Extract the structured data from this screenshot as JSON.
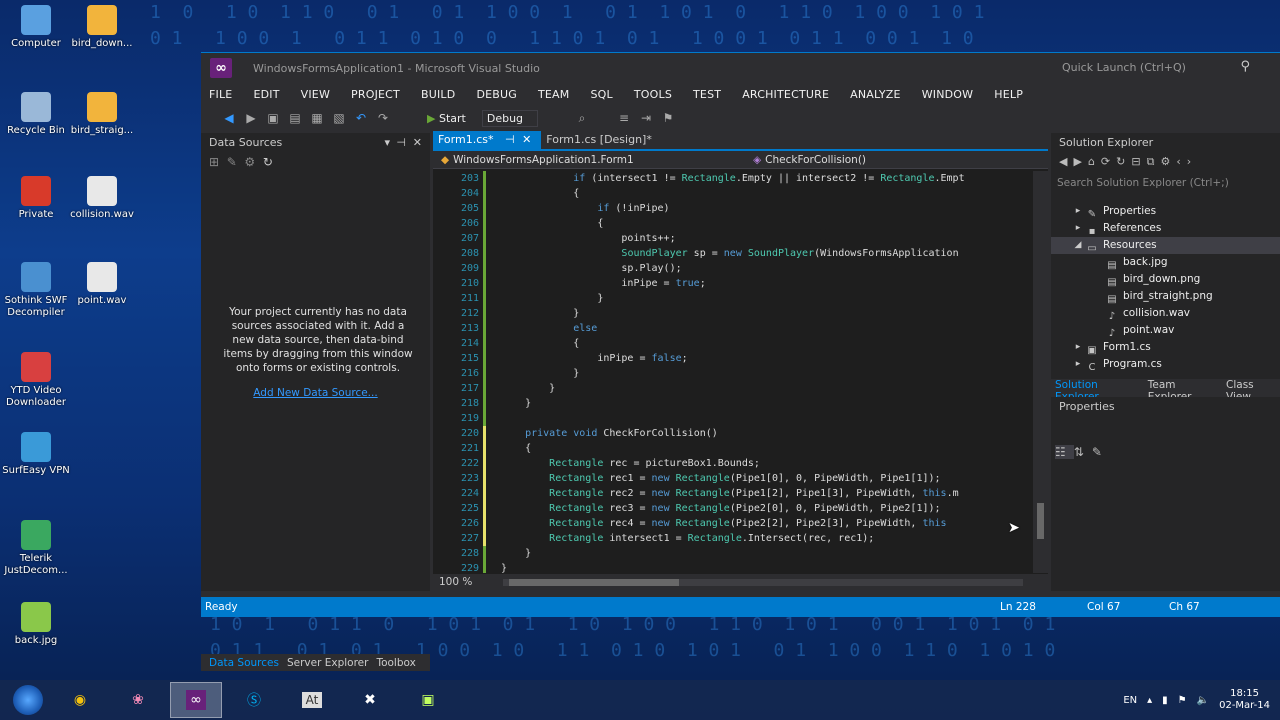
{
  "desktop": {
    "icons": [
      {
        "label": "Computer",
        "color": "#5aa0e0"
      },
      {
        "label": "bird_down...",
        "color": "#f2b43c"
      },
      {
        "label": "Recycle Bin",
        "color": "#9ab8d8"
      },
      {
        "label": "bird_straig...",
        "color": "#f2b43c"
      },
      {
        "label": "Private",
        "color": "#d83a2a"
      },
      {
        "label": "collision.wav",
        "color": "#e8e8e8"
      },
      {
        "label": "Sothink SWF Decompiler",
        "color": "#4a90d0"
      },
      {
        "label": "point.wav",
        "color": "#e8e8e8"
      },
      {
        "label": "YTD Video Downloader",
        "color": "#d84040"
      },
      {
        "label": "SurfEasy VPN",
        "color": "#3a9ad8"
      },
      {
        "label": "Telerik JustDecom...",
        "color": "#3aa860"
      },
      {
        "label": "back.jpg",
        "color": "#8ac84a"
      }
    ]
  },
  "window": {
    "title": "WindowsFormsApplication1 - Microsoft Visual Studio",
    "quick_launch": "Quick Launch (Ctrl+Q)"
  },
  "menu": [
    "FILE",
    "EDIT",
    "VIEW",
    "PROJECT",
    "BUILD",
    "DEBUG",
    "TEAM",
    "SQL",
    "TOOLS",
    "TEST",
    "ARCHITECTURE",
    "ANALYZE",
    "WINDOW",
    "HELP"
  ],
  "toolbar": {
    "start": "Start",
    "config": "Debug"
  },
  "data_sources": {
    "title": "Data Sources",
    "message": "Your project currently has no data sources associated with it. Add a new data source, then data-bind items by dragging from this window onto forms or existing controls.",
    "link": "Add New Data Source...",
    "tabs": [
      "Data Sources",
      "Server Explorer",
      "Toolbox"
    ]
  },
  "editor": {
    "tabs": [
      "Form1.cs*",
      "Form1.cs [Design]*"
    ],
    "nav_left": "WindowsFormsApplication1.Form1",
    "nav_right": "CheckForCollision()",
    "zoom": "100 %",
    "lines": [
      {
        "n": "203",
        "t": "            if (intersect1 != Rectangle.Empty || intersect2 != Rectangle.Empt"
      },
      {
        "n": "204",
        "t": "            {"
      },
      {
        "n": "205",
        "t": "                if (!inPipe)"
      },
      {
        "n": "206",
        "t": "                {"
      },
      {
        "n": "207",
        "t": "                    points++;"
      },
      {
        "n": "208",
        "t": "                    SoundPlayer sp = new SoundPlayer(WindowsFormsApplication"
      },
      {
        "n": "209",
        "t": "                    sp.Play();"
      },
      {
        "n": "210",
        "t": "                    inPipe = true;"
      },
      {
        "n": "211",
        "t": "                }"
      },
      {
        "n": "212",
        "t": "            }"
      },
      {
        "n": "213",
        "t": "            else"
      },
      {
        "n": "214",
        "t": "            {"
      },
      {
        "n": "215",
        "t": "                inPipe = false;"
      },
      {
        "n": "216",
        "t": "            }"
      },
      {
        "n": "217",
        "t": "        }"
      },
      {
        "n": "218",
        "t": "    }"
      },
      {
        "n": "219",
        "t": ""
      },
      {
        "n": "220",
        "t": "    private void CheckForCollision()"
      },
      {
        "n": "221",
        "t": "    {"
      },
      {
        "n": "222",
        "t": "        Rectangle rec = pictureBox1.Bounds;"
      },
      {
        "n": "223",
        "t": "        Rectangle rec1 = new Rectangle(Pipe1[0], 0, PipeWidth, Pipe1[1]);"
      },
      {
        "n": "224",
        "t": "        Rectangle rec2 = new Rectangle(Pipe1[2], Pipe1[3], PipeWidth, this.m"
      },
      {
        "n": "225",
        "t": "        Rectangle rec3 = new Rectangle(Pipe2[0], 0, PipeWidth, Pipe2[1]);"
      },
      {
        "n": "226",
        "t": "        Rectangle rec4 = new Rectangle(Pipe2[2], Pipe2[3], PipeWidth, this"
      },
      {
        "n": "227",
        "t": "        Rectangle intersect1 = Rectangle.Intersect(rec, rec1);"
      },
      {
        "n": "228",
        "t": "    }"
      },
      {
        "n": "229",
        "t": "}"
      }
    ]
  },
  "solution_explorer": {
    "title": "Solution Explorer",
    "search": "Search Solution Explorer (Ctrl+;)",
    "items": [
      {
        "label": "Properties",
        "depth": 1,
        "exp": "▸",
        "icon": "wrench-icon"
      },
      {
        "label": "References",
        "depth": 1,
        "exp": "▸",
        "icon": "references-icon"
      },
      {
        "label": "Resources",
        "depth": 1,
        "exp": "◢",
        "icon": "folder-icon"
      },
      {
        "label": "back.jpg",
        "depth": 2,
        "exp": "",
        "icon": "image-file-icon"
      },
      {
        "label": "bird_down.png",
        "depth": 2,
        "exp": "",
        "icon": "image-file-icon"
      },
      {
        "label": "bird_straight.png",
        "depth": 2,
        "exp": "",
        "icon": "image-file-icon"
      },
      {
        "label": "collision.wav",
        "depth": 2,
        "exp": "",
        "icon": "audio-file-icon"
      },
      {
        "label": "point.wav",
        "depth": 2,
        "exp": "",
        "icon": "audio-file-icon"
      },
      {
        "label": "Form1.cs",
        "depth": 1,
        "exp": "▸",
        "icon": "form-file-icon"
      },
      {
        "label": "Program.cs",
        "depth": 1,
        "exp": "▸",
        "icon": "csharp-file-icon"
      }
    ],
    "tabs": [
      "Solution Explorer",
      "Team Explorer",
      "Class View"
    ]
  },
  "properties": {
    "title": "Properties"
  },
  "status": {
    "text": "Ready",
    "ln": "Ln 228",
    "col": "Col 67",
    "ch": "Ch 67"
  },
  "taskbar": {
    "lang": "EN",
    "time": "18:15",
    "date": "02-Mar-14"
  }
}
